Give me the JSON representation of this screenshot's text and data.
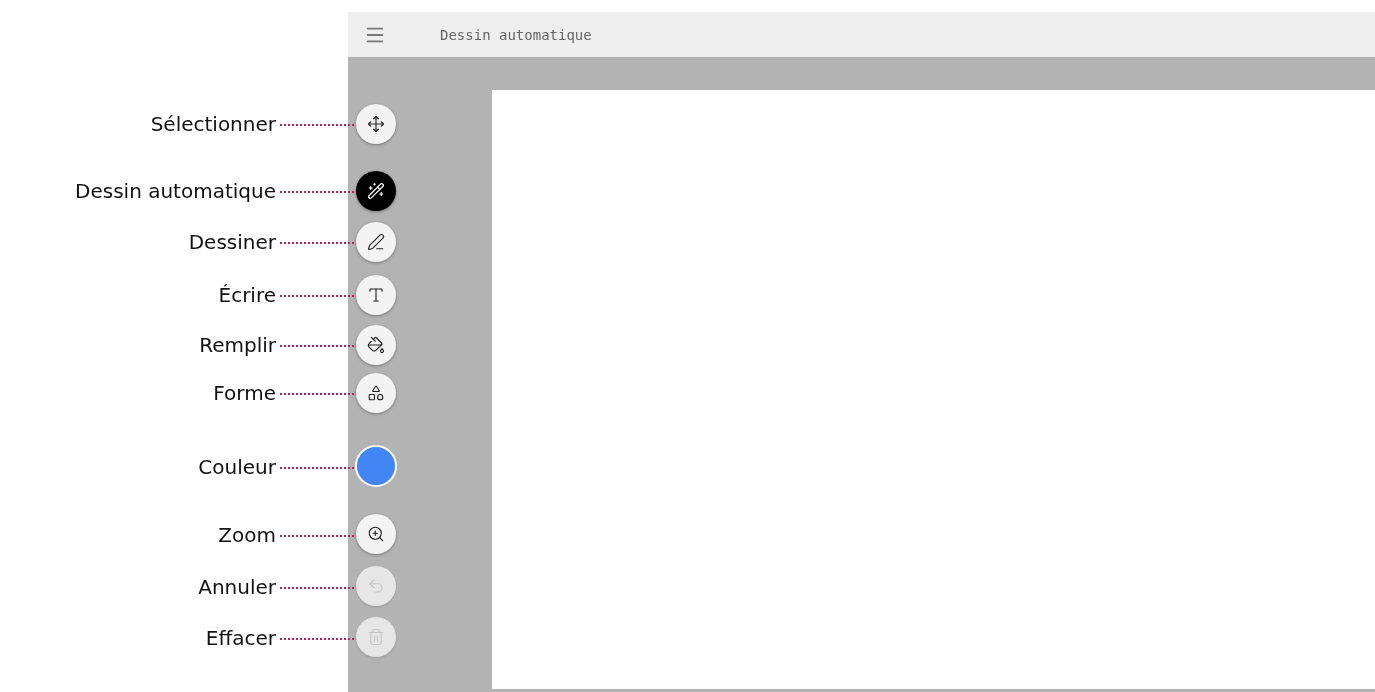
{
  "app_bar": {
    "title": "Dessin automatique"
  },
  "tools": [
    {
      "kind": "select",
      "label": "Sélectionner",
      "selected": false,
      "disabled": false
    },
    {
      "kind": "autodraw",
      "label": "Dessin automatique",
      "selected": true,
      "disabled": false
    },
    {
      "kind": "draw",
      "label": "Dessiner",
      "selected": false,
      "disabled": false
    },
    {
      "kind": "text",
      "label": "Écrire",
      "selected": false,
      "disabled": false
    },
    {
      "kind": "fill",
      "label": "Remplir",
      "selected": false,
      "disabled": false
    },
    {
      "kind": "shape",
      "label": "Forme",
      "selected": false,
      "disabled": false
    },
    {
      "kind": "color",
      "label": "Couleur",
      "color": "#4285f4"
    },
    {
      "kind": "zoom",
      "label": "Zoom",
      "selected": false,
      "disabled": false
    },
    {
      "kind": "undo",
      "label": "Annuler",
      "selected": false,
      "disabled": true
    },
    {
      "kind": "clear",
      "label": "Effacer",
      "selected": false,
      "disabled": true
    }
  ]
}
